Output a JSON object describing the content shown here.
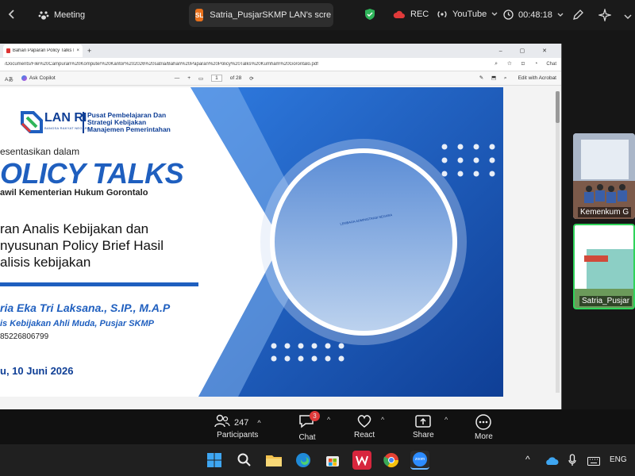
{
  "zoom_top": {
    "meeting_label": "Meeting",
    "share_tab": {
      "badge": "SL",
      "title": "Satria_PusjarSKMP LAN's scre"
    },
    "rec_label": "REC",
    "youtube_label": "YouTube",
    "timer": "00:48:18"
  },
  "browser": {
    "tab_title": "Bahan Paparan Policy Talks Kumh...",
    "address": "/Documents/File%20Campuran%20Komputer%20Kantor%202026%20satria/Bahan%20Paparan%20Policy%20Talks%20Kumham%20Gorontalo.pdf",
    "ask_copilot": "Ask Copilot",
    "page_current": "1",
    "page_total": "of 28",
    "edit_acrobat": "Edit with Acrobat",
    "chat": "Chat"
  },
  "slide": {
    "logo_text": "LAN RI",
    "logo_sub": "BANGSA RAKYAT NEGARA",
    "org_line1": "Pusat Pembelajaran Dan",
    "org_line2": "Strategi Kebijakan",
    "org_line3": "Manajemen Pemerintahan",
    "presented_in": "esentasikan dalam",
    "title": "OLICY TALKS",
    "subtitle": "awil Kementerian Hukum Gorontalo",
    "topic_line1": "ran Analis Kebijakan dan",
    "topic_line2": "nyusunan Policy Brief Hasil",
    "topic_line3": "alisis kebijakan",
    "speaker": "ria Eka Tri Laksana., S.IP., M.A.P",
    "speaker_role": "is Kebijakan Ahli Muda, Pusjar SKMP",
    "phone": "85226806799",
    "date": "u, 10 Juni 2026",
    "building_sign": "LEMBAGA ADMINISTRASI NEGARA"
  },
  "gallery": [
    {
      "name": "Kemenkum G"
    },
    {
      "name": "Satria_Pusjar"
    }
  ],
  "controls": {
    "participants_count": "247",
    "participants": "Participants",
    "chat_badge": "3",
    "chat": "Chat",
    "react": "React",
    "share": "Share",
    "more": "More"
  },
  "taskbar": {
    "zoom_label": "zoom",
    "lang": "ENG"
  },
  "colors": {
    "slide_blue": "#1f5fbf",
    "slide_dark": "#0f3f96",
    "shield_green": "#2fb55a",
    "rec_red": "#e03a3a",
    "active_border": "#2fd35a"
  }
}
